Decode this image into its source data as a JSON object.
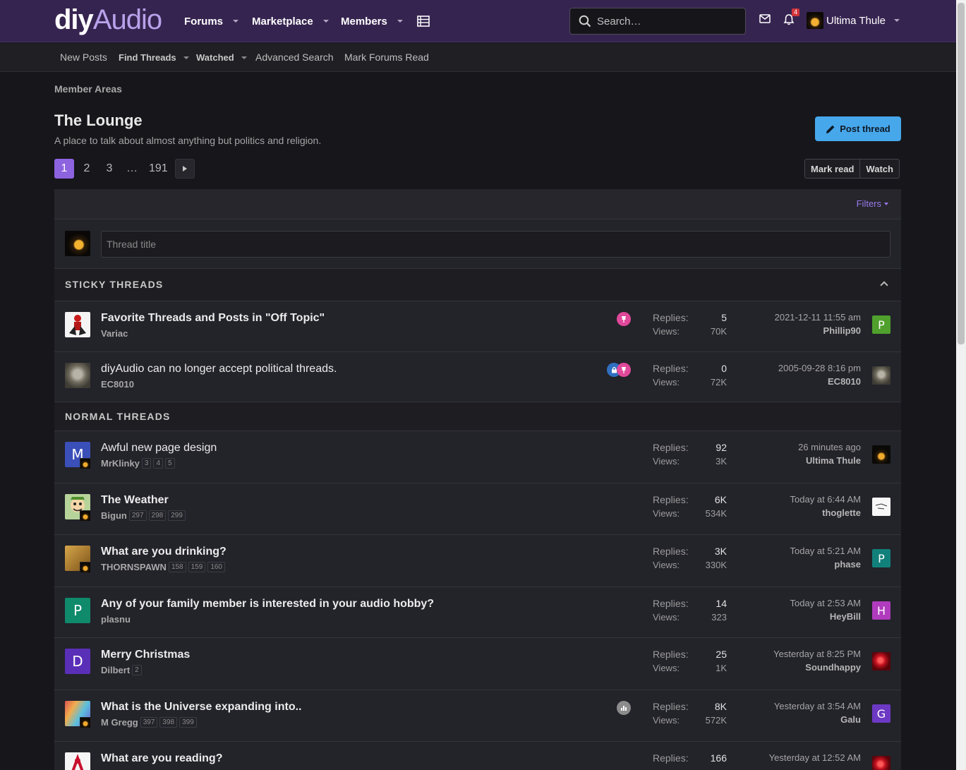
{
  "header": {
    "logo_part1": "diy",
    "logo_part2": "Audio",
    "nav": [
      {
        "label": "Forums"
      },
      {
        "label": "Marketplace"
      },
      {
        "label": "Members"
      }
    ],
    "search_placeholder": "Search…",
    "notifications_count": "4",
    "username": "Ultima Thule"
  },
  "subnav": {
    "new_posts": "New Posts",
    "find_threads": "Find Threads",
    "watched": "Watched",
    "advanced_search": "Advanced Search",
    "mark_forums_read": "Mark Forums Read"
  },
  "page": {
    "breadcrumb": "Member Areas",
    "title": "The Lounge",
    "description": "A place to talk about almost anything but politics and religion.",
    "post_thread": "Post thread",
    "pages": [
      "1",
      "2",
      "3",
      "…",
      "191"
    ],
    "mark_read": "Mark read",
    "watch": "Watch",
    "filters": "Filters",
    "thread_title_placeholder": "Thread title"
  },
  "sections": {
    "sticky": "STICKY THREADS",
    "normal": "NORMAL THREADS"
  },
  "labels": {
    "replies": "Replies:",
    "views": "Views:"
  },
  "threads": [
    {
      "title": "Favorite Threads and Posts in \"Off Topic\"",
      "author": "Variac",
      "replies": "5",
      "views": "70K",
      "last_time": "2021-12-11 11:55 am",
      "last_user": "Phillip90",
      "last_avatar": "P",
      "pages": []
    },
    {
      "title": "diyAudio can no longer accept political threads.",
      "author": "EC8010",
      "replies": "0",
      "views": "72K",
      "last_time": "2005-09-28 8:16 pm",
      "last_user": "EC8010",
      "last_avatar": "",
      "pages": []
    },
    {
      "title": "Awful new page design",
      "author": "MrKlinky",
      "replies": "92",
      "views": "3K",
      "last_time": "26 minutes ago",
      "last_user": "Ultima Thule",
      "last_avatar": "",
      "avatar_letter": "M",
      "pages": [
        "3",
        "4",
        "5"
      ]
    },
    {
      "title": "The Weather",
      "author": "Bigun",
      "replies": "6K",
      "views": "534K",
      "last_time": "Today at 6:44 AM",
      "last_user": "thoglette",
      "last_avatar": "",
      "pages": [
        "297",
        "298",
        "299"
      ]
    },
    {
      "title": "What are you drinking?",
      "author": "THORNSPAWN",
      "replies": "3K",
      "views": "330K",
      "last_time": "Today at 5:21 AM",
      "last_user": "phase",
      "last_avatar": "P",
      "pages": [
        "158",
        "159",
        "160"
      ]
    },
    {
      "title": "Any of your family member is interested in your audio hobby?",
      "author": "plasnu",
      "replies": "14",
      "views": "323",
      "last_time": "Today at 2:53 AM",
      "last_user": "HeyBill",
      "last_avatar": "H",
      "avatar_letter": "P",
      "pages": []
    },
    {
      "title": "Merry Christmas",
      "author": "Dilbert",
      "replies": "25",
      "views": "1K",
      "last_time": "Yesterday at 8:25 PM",
      "last_user": "Soundhappy",
      "last_avatar": "",
      "avatar_letter": "D",
      "pages": [
        "2"
      ]
    },
    {
      "title": "What is the Universe expanding into..",
      "author": "M Gregg",
      "replies": "8K",
      "views": "572K",
      "last_time": "Yesterday at 3:54 AM",
      "last_user": "Galu",
      "last_avatar": "G",
      "pages": [
        "397",
        "398",
        "399"
      ]
    },
    {
      "title": "What are you reading?",
      "author": "",
      "replies": "166",
      "views": "",
      "last_time": "Yesterday at 12:52 AM",
      "last_user": "",
      "last_avatar": "",
      "pages": []
    }
  ],
  "colors": {
    "header_bg": "#362450",
    "accent": "#8e63e0",
    "post_button": "#47a7eb",
    "sticky_icon": "#e0489a",
    "lock_icon": "#2f6fc0"
  }
}
